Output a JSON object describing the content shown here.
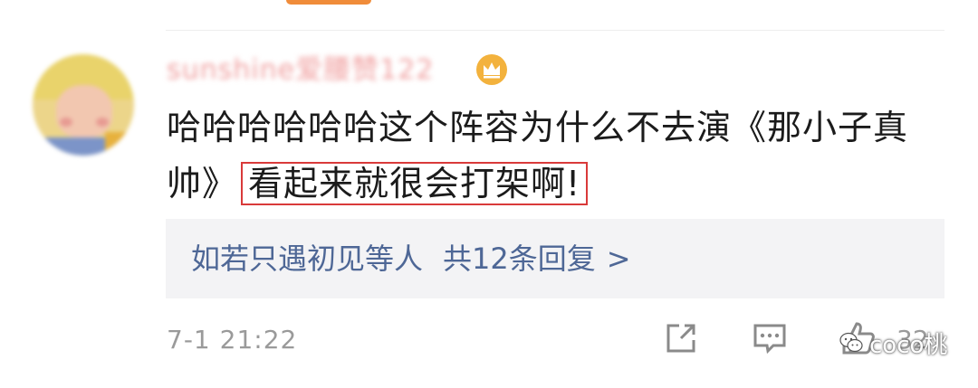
{
  "comment": {
    "username": "sunshine爱腰赞122",
    "text_line1": "哈哈哈哈哈哈这个阵容为什么不去演《那小子真",
    "text_line2_prefix": "帅》",
    "text_highlight": "看起来就很会打架啊!",
    "timestamp": "7-1 21:22",
    "like_count": "32"
  },
  "reply": {
    "names": "如若只遇初见等人",
    "count_label": "共12条回复",
    "chevron": ">"
  },
  "icons": {
    "badge": "crown-icon",
    "share": "share-icon",
    "comment": "comment-icon",
    "like": "like-icon",
    "watermark": "wechat-icon"
  },
  "watermark": {
    "text": "coco桃"
  },
  "colors": {
    "highlight_border": "#d93a3a",
    "reply_link": "#4e6796",
    "reply_bg": "#f3f3f5",
    "meta_gray": "#9a9a9a",
    "badge": "#f3b23d",
    "top_tab": "#f08c3a"
  }
}
